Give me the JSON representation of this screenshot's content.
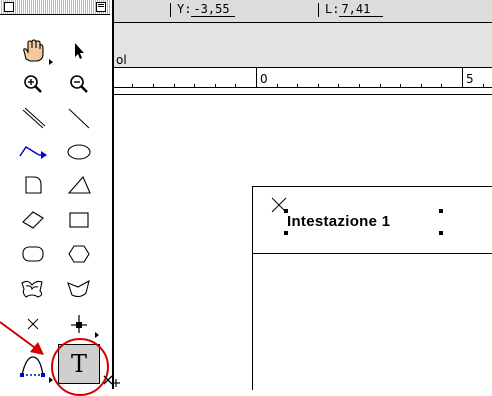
{
  "info_bar": {
    "y_label": "Y:",
    "y_value": "-3,55",
    "l_label": "L:",
    "l_value": "7,41"
  },
  "menu_strip": {
    "partial_label": "ol"
  },
  "ruler": {
    "labels": [
      "0",
      "5"
    ]
  },
  "page": {
    "heading": "Intestazione 1"
  },
  "palette": {
    "tools": [
      {
        "name": "hand-tool",
        "icon": "hand-icon"
      },
      {
        "name": "arrow-tool",
        "icon": "arrow-pointer-icon"
      },
      {
        "name": "zoom-in-tool",
        "icon": "zoom-in-icon"
      },
      {
        "name": "zoom-out-tool",
        "icon": "zoom-out-icon"
      },
      {
        "name": "line-tool",
        "icon": "diagonal-line-icon"
      },
      {
        "name": "line-constrained-tool",
        "icon": "diagonal-line-thin-icon"
      },
      {
        "name": "connector-tool",
        "icon": "connector-arrow-icon"
      },
      {
        "name": "ellipse-tool",
        "icon": "ellipse-icon"
      },
      {
        "name": "rounded-shape-tool",
        "icon": "d-shape-icon"
      },
      {
        "name": "triangle-tool",
        "icon": "triangle-icon"
      },
      {
        "name": "rotated-rectangle-tool",
        "icon": "rotated-rectangle-icon"
      },
      {
        "name": "rectangle-tool",
        "icon": "rectangle-icon"
      },
      {
        "name": "rounded-rectangle-tool",
        "icon": "rounded-rectangle-icon"
      },
      {
        "name": "polygon-tool",
        "icon": "hexagon-icon"
      },
      {
        "name": "freeform-tool",
        "icon": "freeform-icon"
      },
      {
        "name": "curve-tool",
        "icon": "curve-icon"
      },
      {
        "name": "cross-tool",
        "icon": "x-mark-icon"
      },
      {
        "name": "anchor-point-tool",
        "icon": "anchor-point-icon"
      },
      {
        "name": "bezier-tool",
        "icon": "bezier-icon"
      },
      {
        "name": "text-tool",
        "icon": "text-icon",
        "glyph": "T"
      }
    ]
  },
  "colors": {
    "annotation_red": "#d40000",
    "connector_blue": "#0000cc"
  }
}
